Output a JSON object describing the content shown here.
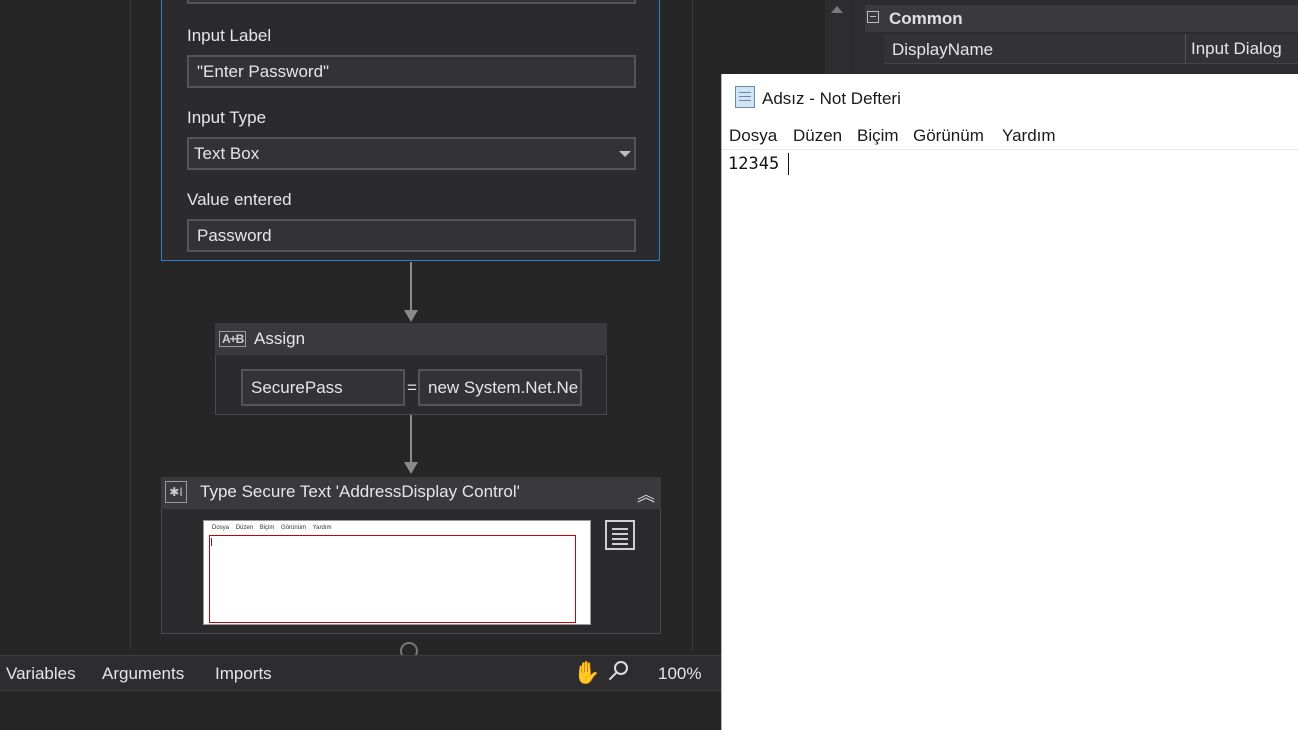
{
  "designer": {
    "input_dialog": {
      "input_label_caption": "Input Label",
      "input_label_value": "\"Enter Password\"",
      "input_type_caption": "Input Type",
      "input_type_value": "Text Box",
      "value_entered_caption": "Value entered",
      "value_entered_value": "Password"
    },
    "assign": {
      "title": "Assign",
      "icon_text": "A+B",
      "left_value": "SecurePass",
      "equals": "=",
      "right_value": "new System.Net.Ne"
    },
    "type_secure_text": {
      "title": "Type Secure Text 'AddressDisplay Control'",
      "thumb_menu": [
        "Dosya",
        "Düzen",
        "Biçim",
        "Görünüm",
        "Yardım"
      ]
    }
  },
  "bottom_bar": {
    "tabs": [
      "Variables",
      "Arguments",
      "Imports"
    ],
    "zoom": "100%"
  },
  "properties": {
    "group": "Common",
    "row_name": "DisplayName",
    "row_value": "Input Dialog"
  },
  "notepad": {
    "title": "Adsız - Not Defteri",
    "menu": [
      "Dosya",
      "Düzen",
      "Biçim",
      "Görünüm",
      "Yardım"
    ],
    "content": "12345"
  },
  "colors": {
    "selection_border": "#2f7fc8",
    "background": "#252526"
  }
}
